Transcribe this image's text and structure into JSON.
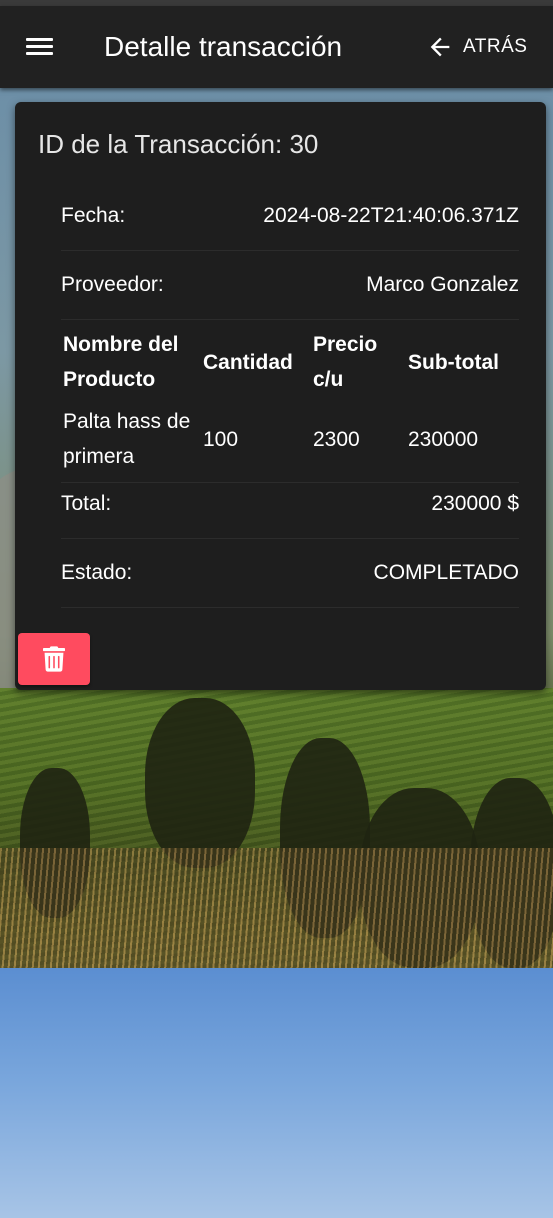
{
  "app_bar": {
    "title": "Detalle transacción",
    "back_label": "ATRÁS",
    "menu_icon": "hamburger-menu-icon",
    "back_icon": "arrow-left-icon"
  },
  "transaction": {
    "title": "ID de la Transacción: 30",
    "fecha_label": "Fecha:",
    "fecha_value": "2024-08-22T21:40:06.371Z",
    "proveedor_label": "Proveedor:",
    "proveedor_value": "Marco Gonzalez",
    "table": {
      "headers": [
        "Nombre del Producto",
        "Cantidad",
        "Precio c/u",
        "Sub-total"
      ],
      "rows": [
        [
          "Palta hass de primera",
          "100",
          "2300",
          "230000"
        ]
      ]
    },
    "total_label": "Total:",
    "total_value": "230000 $",
    "estado_label": "Estado:",
    "estado_value": "COMPLETADO"
  },
  "actions": {
    "delete_icon": "trash-icon"
  },
  "colors": {
    "app_bar": "#212121",
    "card": "#1e1e1e",
    "delete_button": "#ff4b5f",
    "text": "#ffffff"
  }
}
